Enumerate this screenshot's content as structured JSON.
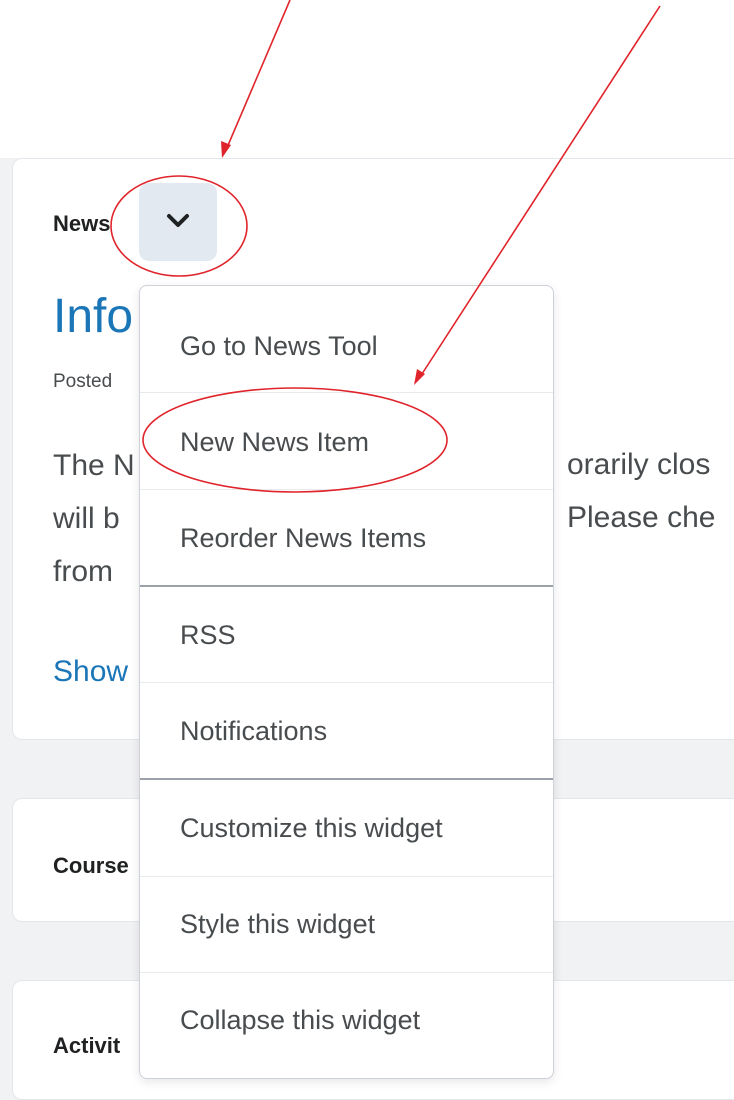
{
  "news_widget": {
    "title": "News",
    "item_title": "Info",
    "posted": "Posted",
    "body_lines": [
      "The N",
      "will b",
      "from "
    ],
    "body_right": [
      "orarily clos",
      "Please che"
    ],
    "show_more": "Show",
    "dropdown_icon": "chevron-down-icon"
  },
  "course_widget": {
    "title": "Course"
  },
  "activity_widget": {
    "title": "Activit"
  },
  "context_menu": {
    "items": [
      "Go to News Tool",
      "New News Item",
      "Reorder News Items",
      "RSS",
      "Notifications",
      "Customize this widget",
      "Style this widget",
      "Collapse this widget"
    ]
  },
  "colors": {
    "annotation": "#e0242b",
    "link": "#1b76b8",
    "button_bg": "#e3e9f1"
  }
}
